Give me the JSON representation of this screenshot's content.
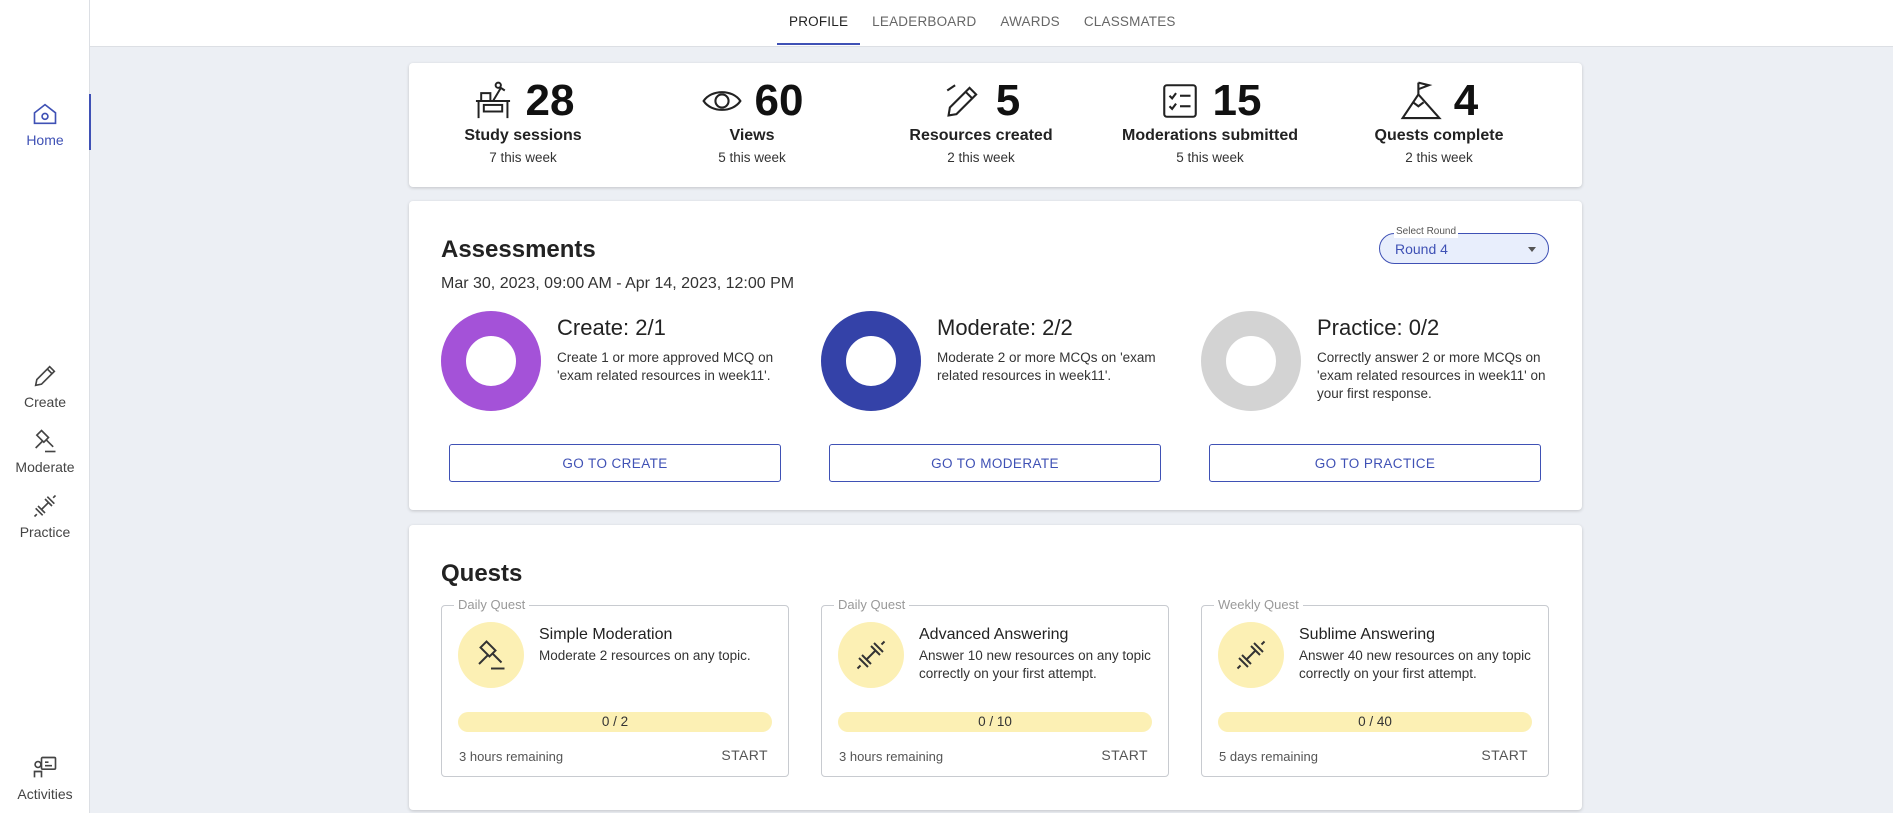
{
  "sidebar": {
    "items": [
      {
        "label": "Home",
        "icon": "home-icon",
        "active": true
      },
      {
        "label": "Create",
        "icon": "pencil-icon"
      },
      {
        "label": "Moderate",
        "icon": "gavel-icon"
      },
      {
        "label": "Practice",
        "icon": "dumbbell-icon"
      },
      {
        "label": "Activities",
        "icon": "activities-icon"
      }
    ]
  },
  "header": {
    "tabs": [
      {
        "label": "PROFILE",
        "active": true
      },
      {
        "label": "LEADERBOARD"
      },
      {
        "label": "AWARDS"
      },
      {
        "label": "CLASSMATES"
      }
    ]
  },
  "stats": [
    {
      "value": "28",
      "label": "Study sessions",
      "sub": "7 this week",
      "icon": "study-desk-icon"
    },
    {
      "value": "60",
      "label": "Views",
      "sub": "5 this week",
      "icon": "eye-icon"
    },
    {
      "value": "5",
      "label": "Resources created",
      "sub": "2 this week",
      "icon": "pencil-icon"
    },
    {
      "value": "15",
      "label": "Moderations submitted",
      "sub": "5 this week",
      "icon": "checklist-icon"
    },
    {
      "value": "4",
      "label": "Quests complete",
      "sub": "2 this week",
      "icon": "mountain-flag-icon"
    }
  ],
  "assessments": {
    "title": "Assessments",
    "date_range": "Mar 30, 2023, 09:00 AM - Apr 14, 2023, 12:00 PM",
    "select": {
      "label": "Select Round",
      "value": "Round 4"
    },
    "tasks": [
      {
        "title": "Create: 2/1",
        "desc": "Create 1 or more approved MCQ on 'exam related resources in week11'.",
        "button": "GO TO CREATE",
        "color": "#a452d8",
        "progress": 1
      },
      {
        "title": "Moderate: 2/2",
        "desc": "Moderate 2 or more MCQs on 'exam related resources in week11'.",
        "button": "GO TO MODERATE",
        "color": "#3442a8",
        "progress": 1
      },
      {
        "title": "Practice: 0/2",
        "desc": "Correctly answer 2 or more MCQs on 'exam related resources in week11' on your first response.",
        "button": "GO TO PRACTICE",
        "color": "#d3d3d3",
        "progress": 0
      }
    ]
  },
  "quests": {
    "title": "Quests",
    "items": [
      {
        "type": "Daily Quest",
        "title": "Simple Moderation",
        "desc": "Moderate 2 resources on any topic.",
        "progress_text": "0 / 2",
        "progress": 0,
        "remaining": "3 hours remaining",
        "action": "START",
        "icon": "gavel-icon"
      },
      {
        "type": "Daily Quest",
        "title": "Advanced Answering",
        "desc": "Answer 10 new resources on any topic correctly on your first attempt.",
        "progress_text": "0 / 10",
        "progress": 0,
        "remaining": "3 hours remaining",
        "action": "START",
        "icon": "dumbbell-icon"
      },
      {
        "type": "Weekly Quest",
        "title": "Sublime Answering",
        "desc": "Answer 40 new resources on any topic correctly on your first attempt.",
        "progress_text": "0 / 40",
        "progress": 0,
        "remaining": "5 days remaining",
        "action": "START",
        "icon": "dumbbell-icon"
      }
    ]
  },
  "colors": {
    "accent": "#3f51b5",
    "quest_yellow": "#fcf0b4"
  }
}
